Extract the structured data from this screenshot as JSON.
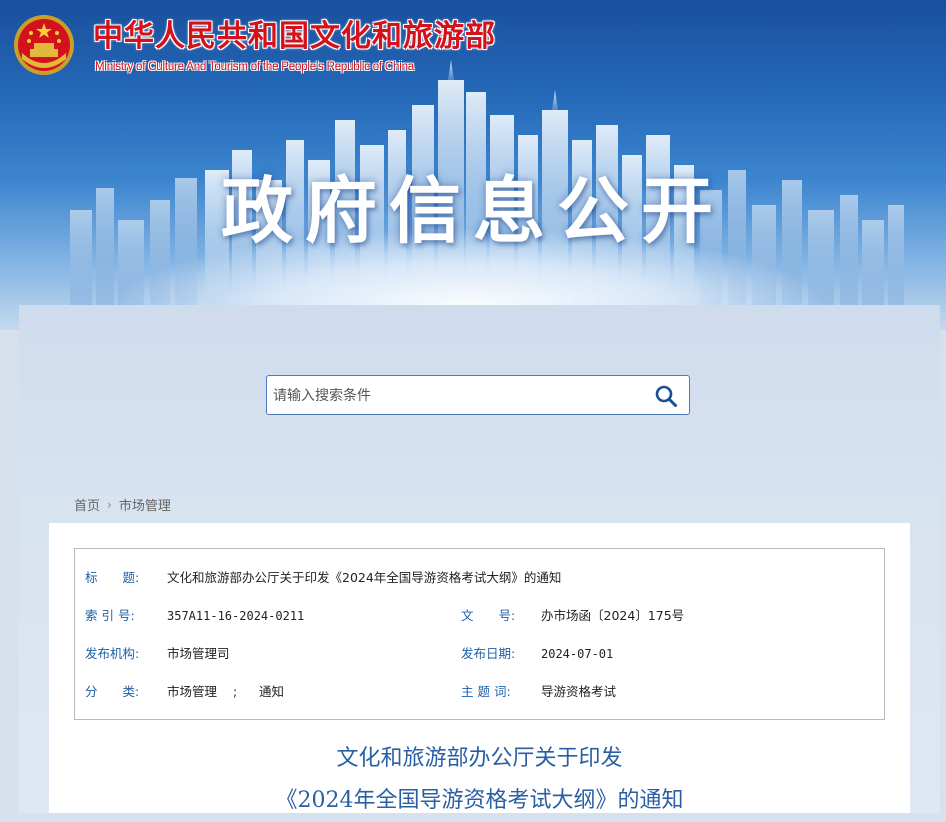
{
  "header": {
    "title_cn": "中华人民共和国文化和旅游部",
    "title_en": "Ministry of Culture And Tourism of the People’s Republic of China",
    "hero": "政府信息公开"
  },
  "search": {
    "placeholder": "请输入搜索条件"
  },
  "breadcrumb": {
    "home": "首页",
    "current": "市场管理"
  },
  "meta": {
    "title_label": "标　　题:",
    "title_value": "文化和旅游部办公厅关于印发《2024年全国导游资格考试大纲》的通知",
    "index_label": "索 引 号:",
    "index_value": "357A11-16-2024-0211",
    "docno_label": "文　　号:",
    "docno_value": "办市场函〔2024〕175号",
    "org_label": "发布机构:",
    "org_value": "市场管理司",
    "date_label": "发布日期:",
    "date_value": "2024-07-01",
    "category_label": "分　　类:",
    "category_value_1": "市场管理",
    "category_sep": ";",
    "category_value_2": "通知",
    "topic_label": "主 题 词:",
    "topic_value": "导游资格考试"
  },
  "doc": {
    "title_line1": "文化和旅游部办公厅关于印发",
    "title_line2": "《2024年全国导游资格考试大纲》的通知"
  },
  "colors": {
    "brand_red": "#d3121b",
    "link_blue": "#1e5fa8",
    "title_blue": "#2a5fa3"
  },
  "icons": [
    "national-emblem-icon",
    "search-icon",
    "chevron-right-icon"
  ]
}
